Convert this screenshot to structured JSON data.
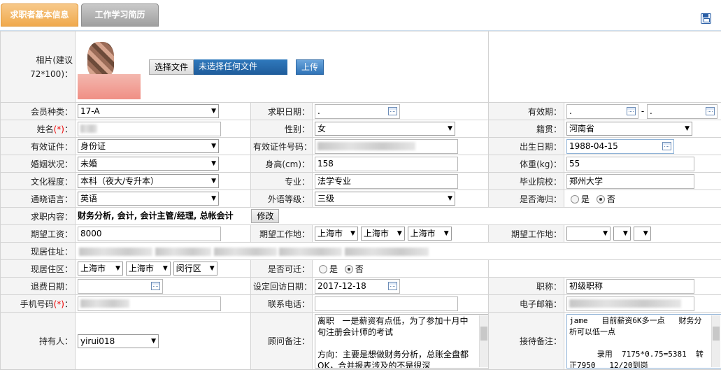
{
  "tabs": [
    {
      "label": "求职者基本信息"
    },
    {
      "label": "工作学习简历"
    }
  ],
  "photo": {
    "label": "相片(建议72*100)：",
    "choose_button": "选择文件",
    "file_status": "未选择任何文件",
    "upload_button": "上传"
  },
  "row1": {
    "member_type_label": "会员种类：",
    "member_type": "17-A",
    "apply_date_label": "求职日期：",
    "apply_date": ".",
    "validity_label": "有效期：",
    "validity_from": ".",
    "validity_sep": "-",
    "validity_to": "."
  },
  "row2": {
    "name_label": "姓名",
    "name_req": "(*)",
    "name_colon": "：",
    "gender_label": "性别：",
    "gender": "女",
    "native_label": "籍贯：",
    "native": "河南省"
  },
  "row3": {
    "id_type_label": "有效证件：",
    "id_type": "身份证",
    "id_no_label": "有效证件号码：",
    "birth_label": "出生日期：",
    "birth": "1988-04-15"
  },
  "row4": {
    "marital_label": "婚姻状况：",
    "marital": "未婚",
    "height_label": "身高(cm)：",
    "height": "158",
    "weight_label": "体重(kg)：",
    "weight": "55"
  },
  "row5": {
    "edu_label": "文化程度：",
    "edu": "本科（夜大/专升本）",
    "major_label": "专业：",
    "major": "法学专业",
    "school_label": "毕业院校：",
    "school": "郑州大学"
  },
  "row6": {
    "lang_label": "通晓语言：",
    "lang": "英语",
    "lang_level_label": "外语等级：",
    "lang_level": "三级",
    "returnee_label": "是否海归：",
    "yes": "是",
    "no": "否"
  },
  "row7": {
    "job_label": "求职内容：",
    "job": "财务分析, 会计, 会计主管/经理, 总帐会计",
    "modify_button": "修改"
  },
  "row8": {
    "salary_label": "期望工资：",
    "salary": "8000",
    "work_place_label": "期望工作地：",
    "work_place": [
      "上海市",
      "上海市",
      "上海市"
    ],
    "work_place2_label": "期望工作地："
  },
  "row9": {
    "address_label": "现居住址："
  },
  "row10": {
    "district_label": "现居住区：",
    "district": [
      "上海市",
      "上海市",
      "闵行区"
    ],
    "relocate_label": "是否可迁：",
    "yes": "是",
    "no": "否"
  },
  "row11": {
    "refund_label": "退费日期：",
    "visit_label": "设定回访日期：",
    "visit": "2017-12-18",
    "title_label": "职称：",
    "title": "初级职称"
  },
  "row12": {
    "phone_label": "手机号码",
    "phone_req": "(*)",
    "phone_colon": "：",
    "tel_label": "联系电话：",
    "email_label": "电子邮箱："
  },
  "row13": {
    "holder_label": "持有人：",
    "holder": "yirui018",
    "consultant_label": "顾问备注：",
    "consultant_note": "离职   一是薪资有点低，为了参加十月中旬注册会计师的考试\n\n方向：主要是想做财务分析，总账全盘都OK，合并报表涉及的不是很深",
    "reception_label": "接待备注：",
    "reception_note": "jame   目前薪资6K多一点   财务分析可以低一点\n\n      录用  7175*0.75=5381  转正7950   12/20到岗"
  }
}
